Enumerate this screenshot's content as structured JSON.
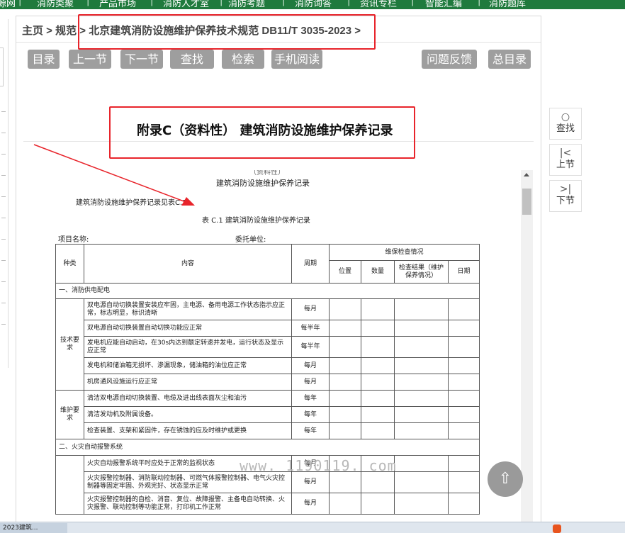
{
  "top_nav": {
    "items": [
      "源网",
      "消防类聚",
      "产品市场",
      "消防人才室",
      "消防考题",
      "消防询答",
      "资讯专栏",
      "智能汇编",
      "消防题库"
    ]
  },
  "breadcrumb": {
    "text": "主页 > 规范 > 北京建筑消防设施维护保养技术规范 DB11/T 3035-2023 >"
  },
  "toolbar": {
    "toc": "目录",
    "prev": "上一节",
    "next": "下一节",
    "find": "查找",
    "search": "检索",
    "mobile": "手机阅读",
    "feedback": "问题反馈",
    "all_toc": "总目录"
  },
  "section_title": "附录C（资料性） 建筑消防设施维护保养记录",
  "document": {
    "top_cut": "（资料性）",
    "heading": "建筑消防设施维护保养记录",
    "intro": "建筑消防设施维护保养记录见表C.1。",
    "table_caption": "表 C.1  建筑消防设施维护保养记录",
    "project_label": "项目名称:",
    "client_label": "委托单位:",
    "headers": {
      "kind": "种类",
      "content": "内容",
      "period": "周期",
      "check": "维保检查情况",
      "position": "位置",
      "qty": "数量",
      "result": "检查结果（维护保养情况）",
      "date": "日期"
    },
    "section1": "一、消防供电配电",
    "group_tech": "技术要求",
    "group_maint": "维护要求",
    "rows1": [
      {
        "content": "双电源自动切换装置安装应牢固，主电源、备用电源工作状态指示应正常，标志明显，标识清晰",
        "period": "每月"
      },
      {
        "content": "双电源自动切换装置自动切换功能应正常",
        "period": "每半年"
      },
      {
        "content": "发电机应能自动启动，在30s内达到额定转速并发电，运行状态及显示应正常",
        "period": "每半年"
      },
      {
        "content": "发电机和储油箱无损坏、渗漏现象，储油箱的油位应正常",
        "period": "每月"
      },
      {
        "content": "机房通风设施运行应正常",
        "period": "每月"
      }
    ],
    "rows2": [
      {
        "content": "清洁双电源自动切换装置、电缆及进出线表面灰尘和油污",
        "period": "每年"
      },
      {
        "content": "清洁发动机及附属设备。",
        "period": "每年"
      },
      {
        "content": "检查装置、支架和紧固件，存在锈蚀的应及时维护或更换",
        "period": "每年"
      }
    ],
    "section2": "二、火灾自动报警系统",
    "rows3": [
      {
        "content": "火灾自动报警系统平时应处于正常的监视状态",
        "period": "每月"
      },
      {
        "content": "火灾报警控制器、消防联动控制器、可燃气体报警控制器、电气火灾控制器等固定牢固、外观完好、状态显示正常",
        "period": "每月"
      },
      {
        "content": "火灾报警控制器的自检、消音、复位、故障报警、主备电自动转换、火灾报警、联动控制等功能正常，打印机工作正常",
        "period": "每月"
      }
    ]
  },
  "side_tools": {
    "find": "查找",
    "prev": "上节",
    "next": "下节"
  },
  "watermark": "www. 1190119. com",
  "taskbar": {
    "task_label": "2023建筑..."
  },
  "colors": {
    "nav_green": "#1f7a3d",
    "button_gray": "#9e9e9e",
    "annotation_red": "#e8242b"
  }
}
